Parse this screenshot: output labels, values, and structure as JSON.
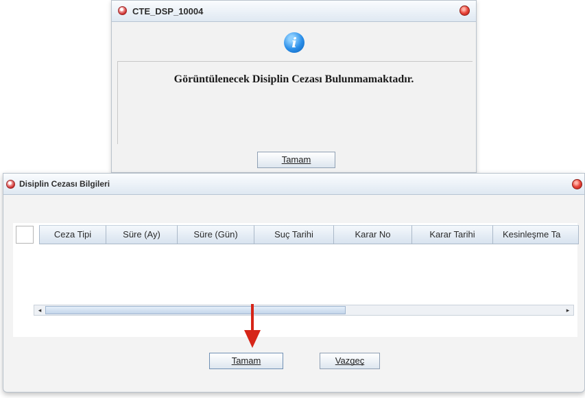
{
  "top_dialog": {
    "title": "CTE_DSP_10004",
    "message": "Görüntülenecek Disiplin Cezası Bulunmamaktadır.",
    "info_glyph": "i",
    "ok_label": "Tamam"
  },
  "bottom_dialog": {
    "title": "Disiplin Cezası Bilgileri",
    "columns": [
      "Ceza Tipi",
      "Süre (Ay)",
      "Süre (Gün)",
      "Suç Tarihi",
      "Karar No",
      "Karar Tarihi",
      "Kesinleşme Ta"
    ],
    "ok_label": "Tamam",
    "cancel_label": "Vazgeç",
    "scroll_left": "◂",
    "scroll_right": "▸"
  },
  "colors": {
    "arrow_red": "#d62518",
    "title_gradient_top": "#fafcfe",
    "title_gradient_bottom": "#dfe8f2"
  },
  "icons": {
    "app_icon": "app-icon",
    "close": "close-icon",
    "info": "info-icon",
    "annotation_arrow": "arrow-down-icon"
  }
}
